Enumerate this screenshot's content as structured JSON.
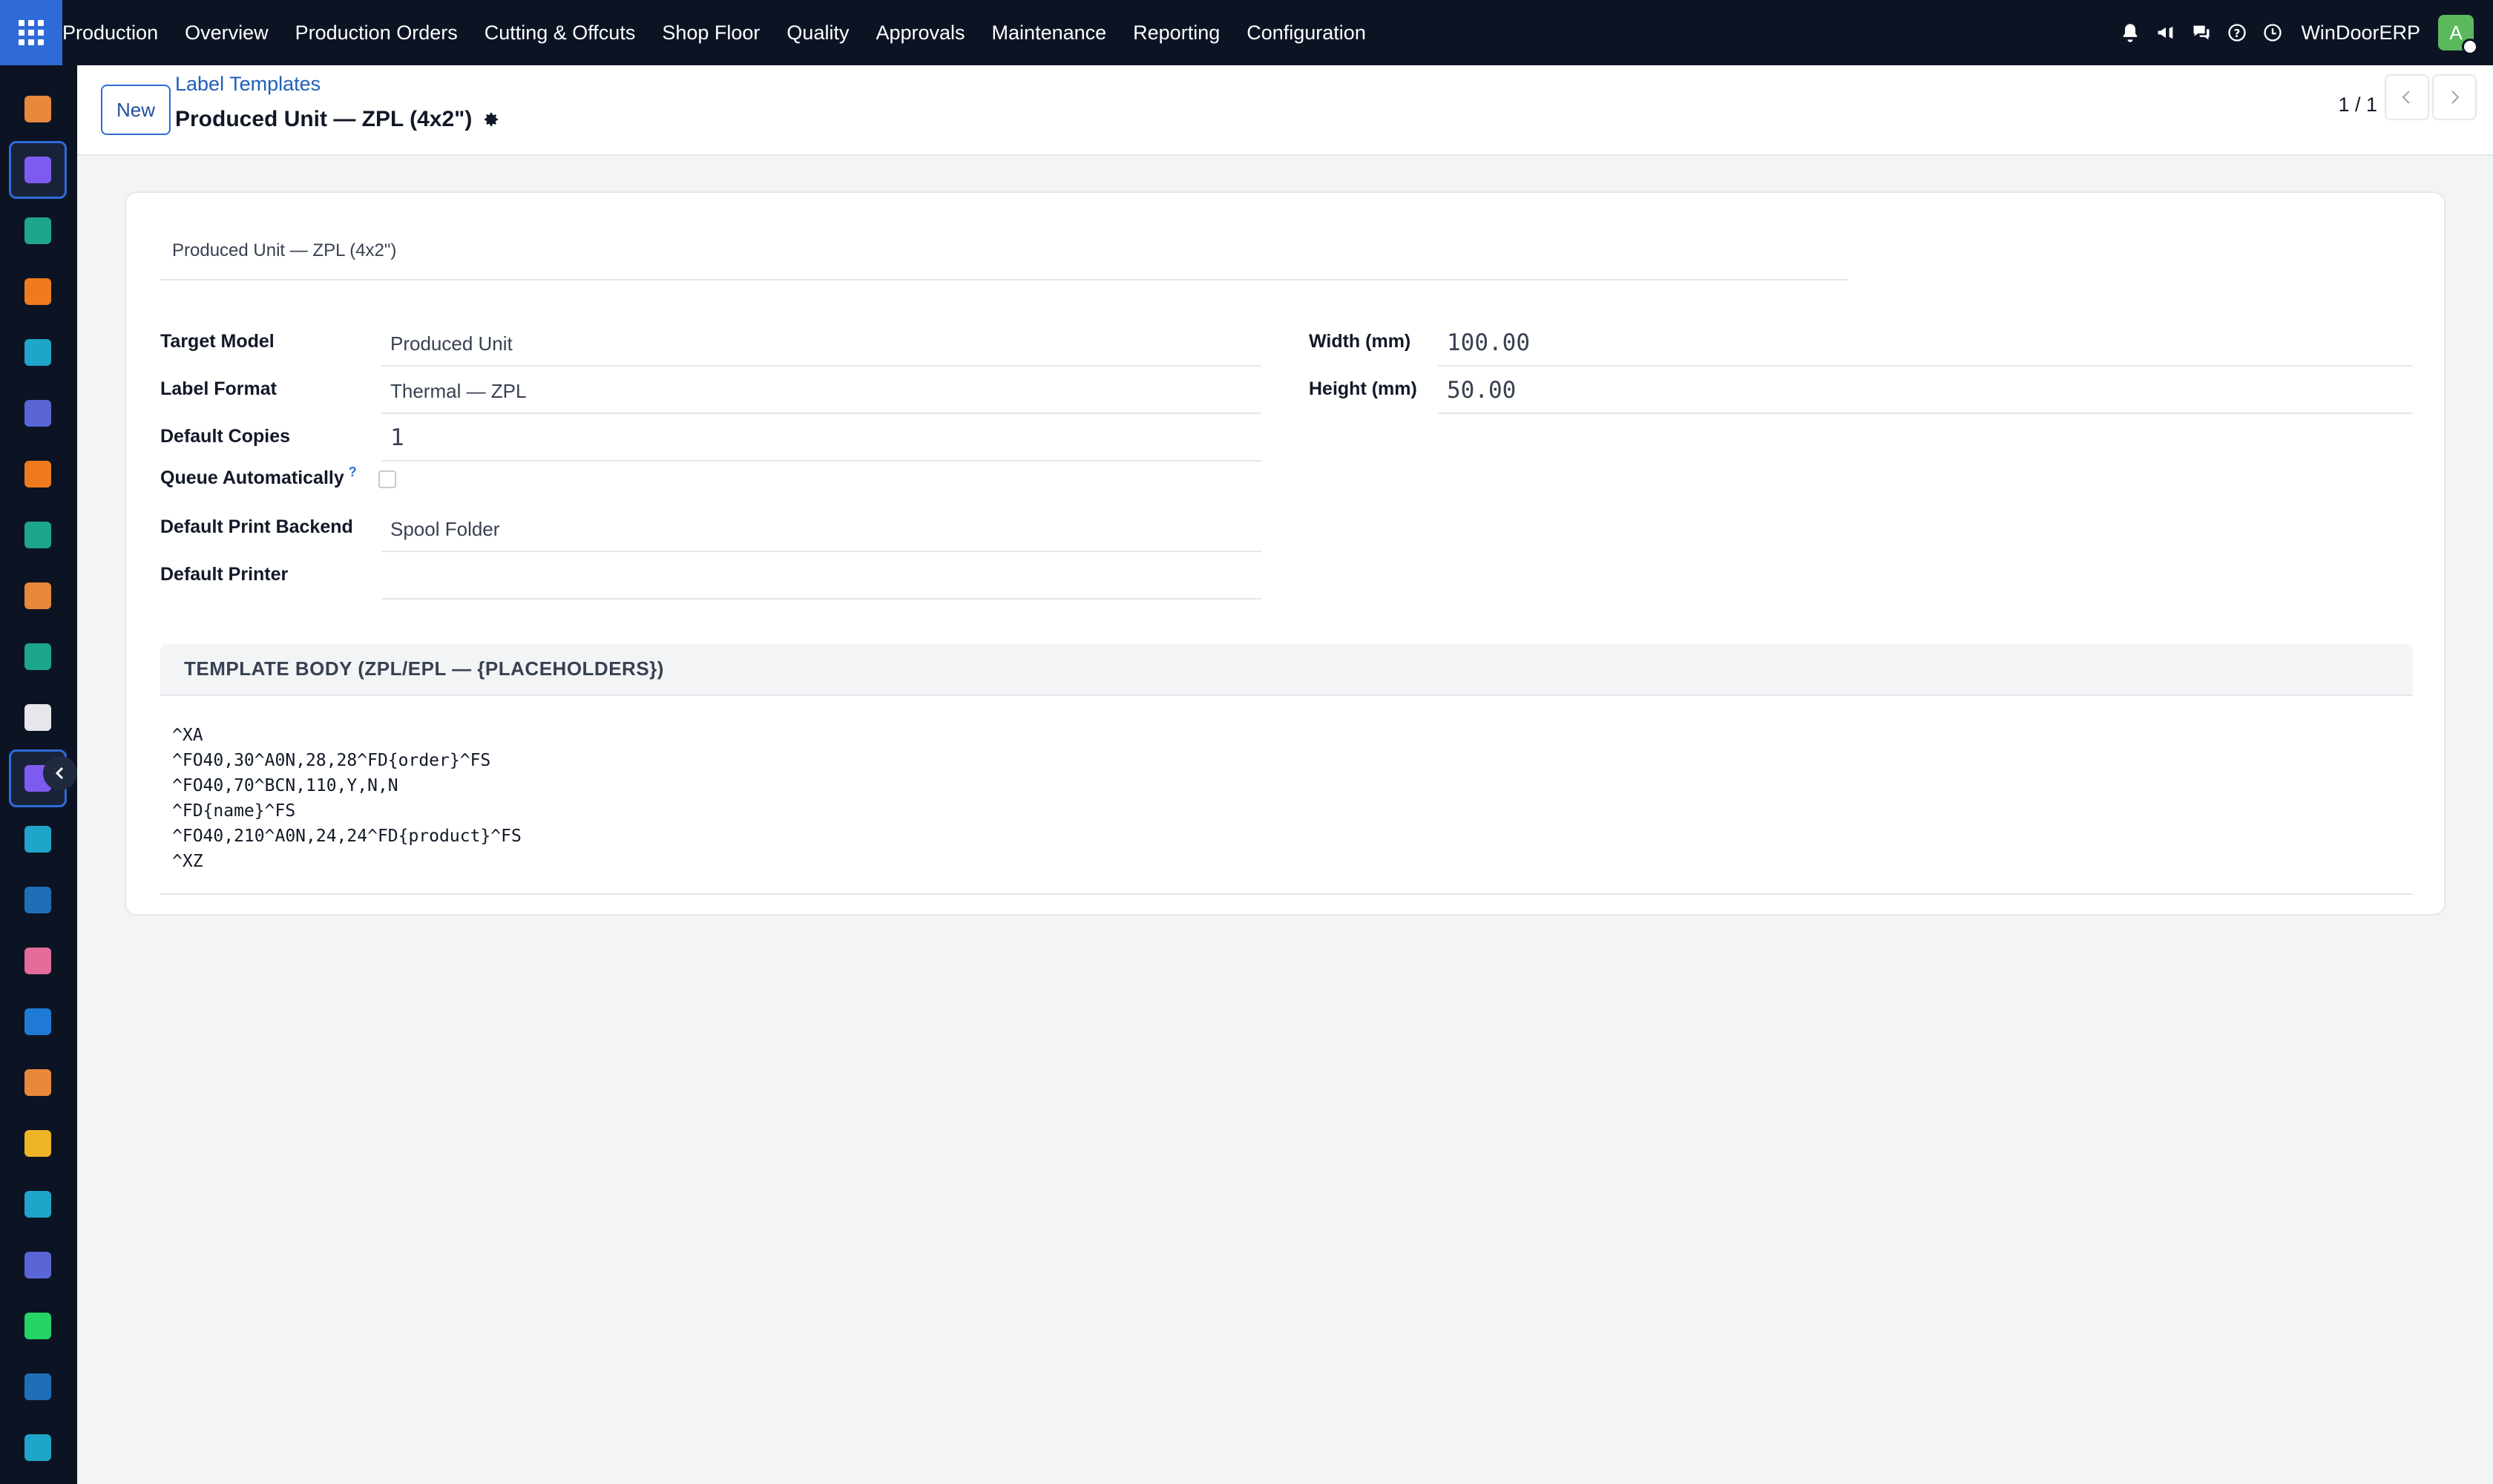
{
  "topbar": {
    "menu": [
      "Production",
      "Overview",
      "Production Orders",
      "Cutting & Offcuts",
      "Shop Floor",
      "Quality",
      "Approvals",
      "Maintenance",
      "Reporting",
      "Configuration"
    ],
    "company": "WinDoorERP",
    "avatar_letter": "A",
    "icons": [
      "bell-icon",
      "megaphone-icon",
      "chat-icon",
      "help-icon",
      "clock-icon"
    ]
  },
  "sidebar": {
    "apps": [
      {
        "name": "manufacturing-app-icon",
        "color": "#e8883a"
      },
      {
        "name": "production-app-icon",
        "color": "#7e5bef",
        "active": true
      },
      {
        "name": "contacts-app-icon",
        "color": "#1ea68a"
      },
      {
        "name": "discuss-app-icon",
        "color": "#f07b1d"
      },
      {
        "name": "website-app-icon",
        "color": "#1fa5c9"
      },
      {
        "name": "mail-app-icon",
        "color": "#5a65d6"
      },
      {
        "name": "chat-app-icon",
        "color": "#f07b1d"
      },
      {
        "name": "project-app-icon",
        "color": "#1ea68a"
      },
      {
        "name": "inventory-app-icon",
        "color": "#e8883a"
      },
      {
        "name": "employees-app-icon",
        "color": "#1ea68a"
      },
      {
        "name": "package-app-icon",
        "color": "#e5e7eb"
      },
      {
        "name": "production-app-icon-2",
        "color": "#7e5bef",
        "active": true
      },
      {
        "name": "approvals-app-icon",
        "color": "#1fa5c9"
      },
      {
        "name": "knowledge-app-icon",
        "color": "#1f6fb8"
      },
      {
        "name": "barcode-app-icon",
        "color": "#e56b9b"
      },
      {
        "name": "accounting-app-icon",
        "color": "#1f7ad6"
      },
      {
        "name": "team-app-icon",
        "color": "#e8883a"
      },
      {
        "name": "calendar-app-icon",
        "color": "#f0b429"
      },
      {
        "name": "sign-app-icon",
        "color": "#1fa5c9"
      },
      {
        "name": "dashboard-app-icon",
        "color": "#5a65d6"
      },
      {
        "name": "whatsapp-app-icon",
        "color": "#25d366"
      },
      {
        "name": "timer-app-icon",
        "color": "#1f6fb8"
      },
      {
        "name": "website-app-icon-2",
        "color": "#1fa5c9"
      }
    ]
  },
  "control": {
    "new_label": "New",
    "breadcrumb": "Label Templates",
    "title": "Produced Unit — ZPL (4x2\")",
    "pager": "1 / 1"
  },
  "form": {
    "name": "Produced Unit — ZPL (4x2\")",
    "target_model_label": "Target Model",
    "target_model": "Produced Unit",
    "label_format_label": "Label Format",
    "label_format": "Thermal — ZPL",
    "default_copies_label": "Default Copies",
    "default_copies": "1",
    "queue_auto_label": "Queue Automatically",
    "queue_auto_help": "?",
    "queue_auto": false,
    "print_backend_label": "Default Print Backend",
    "print_backend": "Spool Folder",
    "printer_label": "Default Printer",
    "printer": "",
    "width_label": "Width (mm)",
    "width": "100.00",
    "height_label": "Height (mm)",
    "height": "50.00",
    "section_title": "TEMPLATE BODY (ZPL/EPL — {PLACEHOLDERS})",
    "template_body": "^XA\n^FO40,30^A0N,28,28^FD{order}^FS\n^FO40,70^BCN,110,Y,N,N\n^FD{name}^FS\n^FO40,210^A0N,24,24^FD{product}^FS\n^XZ"
  }
}
